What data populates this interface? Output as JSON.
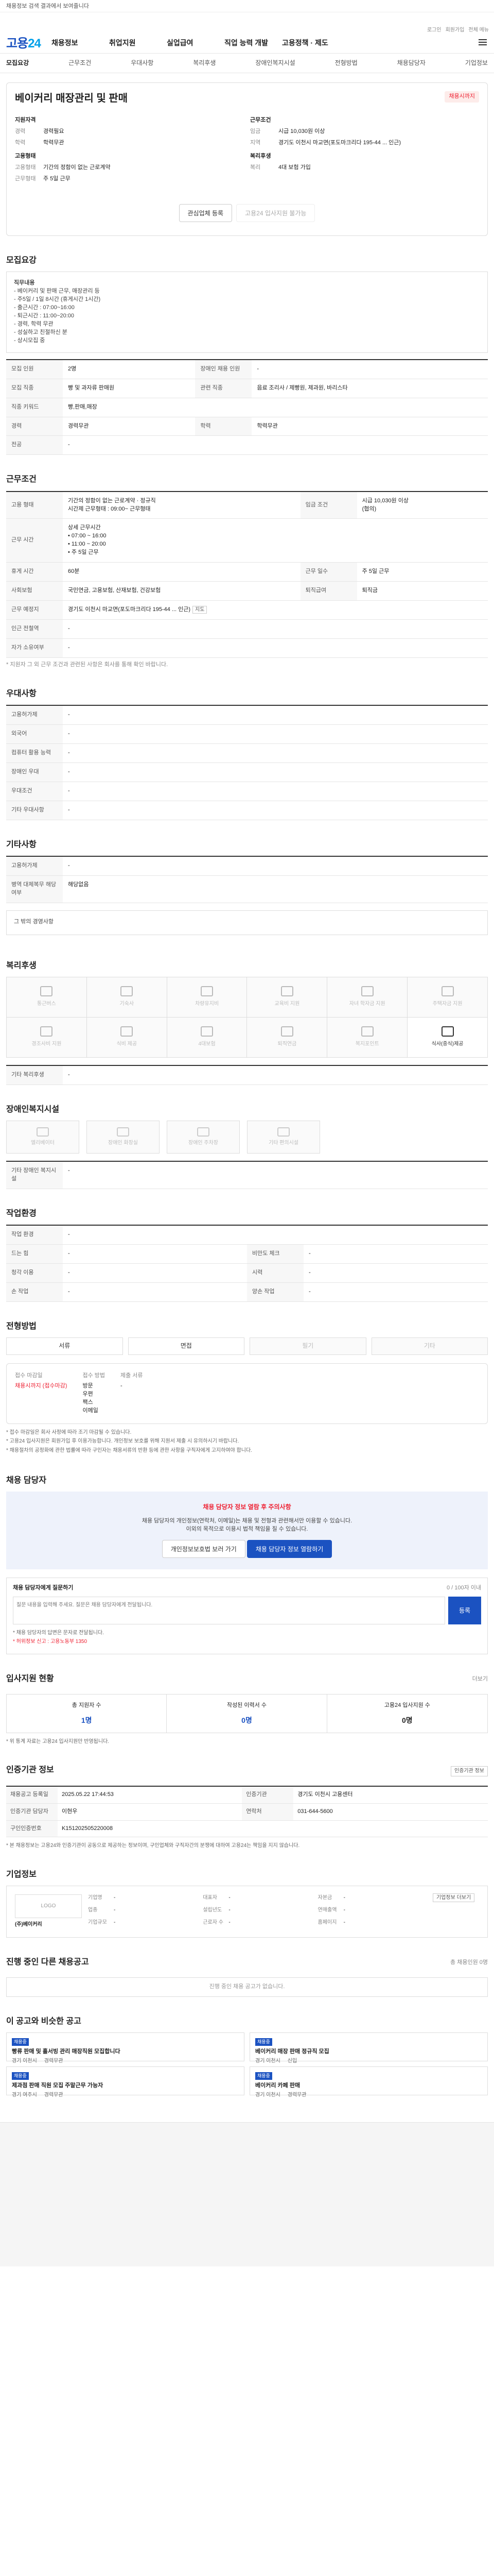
{
  "topnote": "채용정보 검색 결과에서 보여줄니다",
  "brand": {
    "a": "고용",
    "b": "24"
  },
  "utils": [
    "로그인",
    "회원가입",
    "전체 메뉴"
  ],
  "gnb": [
    "채용정보",
    "취업지원",
    "실업급여",
    "직업 능력 개발",
    "고용정책 · 제도"
  ],
  "tabs": [
    "모집요강",
    "근무조건",
    "우대사항",
    "복리후생",
    "장애인복지시설",
    "전형방법",
    "채용담당자",
    "기업정보"
  ],
  "job": {
    "title": "베이커리 매장관리 및 판매",
    "dday": "채용시까지",
    "left": [
      [
        "지원자격",
        ""
      ],
      [
        "경력",
        "경력필요"
      ],
      [
        "학력",
        "학력무관"
      ]
    ],
    "right": [
      [
        "근무조건",
        ""
      ],
      [
        "임금",
        "시급 10,030원 이상"
      ],
      [
        "지역",
        "경기도 이천시 마교면(포도마크리다 195-44 ... 인근)"
      ]
    ],
    "left2_head": "고용형태",
    "left2": [
      [
        "고용형태",
        "기간의 정함이 없는 근로계약"
      ],
      [
        "근무형태",
        "주 5일 근무"
      ]
    ],
    "right2_head": "복리후생",
    "right2": [
      [
        "복리",
        "4대 보험 가입"
      ]
    ],
    "btn_scrap": "관심업체 등록",
    "btn_apply": "고용24 입사지원 불가능"
  },
  "recruit": {
    "title": "모집요강",
    "content_title": "직무내용",
    "content": "- 베이커리 및 판매 근무, 매장관리 등\n- 주5일 / 1일 8시간 (휴게시간 1시간)\n- 출근시간 : 07:00~16:00\n- 퇴근시간 : 11:00~20:00\n- 경력, 학력 무관\n- 성실하고 친절하신 분\n- 상시모집 중",
    "rows": [
      [
        "모집 인원",
        "2명",
        "장애인 채용 인원",
        "-"
      ],
      [
        "모집 직종",
        "빵 및 과자류 판매원",
        "관련 직종",
        "음료 조리사 / 제빵원, 제과원, 바리스타"
      ],
      [
        "직종 키워드",
        "빵,판매,매장",
        null,
        null
      ],
      [
        "경력",
        "경력무관",
        "학력",
        "학력무관"
      ],
      [
        "전공",
        "-",
        null,
        null
      ]
    ]
  },
  "cond": {
    "title": "근무조건",
    "rows": [
      [
        "고용 형태",
        "기간의 정함이 없는 근로계약 · 정규직\n시간제 근무형태 : 09:00~ 근무형태",
        "임금 조건",
        "시급 10,030원 이상\n(협의)"
      ],
      [
        "근무 시간",
        "상세 근무시간\n• 07:00 ~ 16:00\n• 11:00 ~ 20:00\n• 주 5일 근무",
        null,
        null
      ],
      [
        "휴게 시간",
        "60분",
        "근무 일수",
        "주 5일 근무"
      ],
      [
        "사회보험",
        "국민연금, 고용보험, 산재보험, 건강보험",
        "퇴직급여",
        "퇴직금"
      ],
      [
        "근무 예정지",
        "경기도 이천시 마교면(포도마크리다 195-44 ... 인근)",
        null,
        null
      ],
      [
        "인근 전철역",
        "-",
        null,
        null
      ],
      [
        "자가 소유여부",
        "-",
        null,
        null
      ]
    ],
    "note": "* 지원자 그 외 근무 조건과 관련된 사항은 회사를 통해 확인 바랍니다.",
    "map": "지도"
  },
  "pref": {
    "title": "우대사항",
    "rows": [
      [
        "고용허가제",
        "-"
      ],
      [
        "외국어",
        "-"
      ],
      [
        "컴퓨터 활용 능력",
        "-"
      ],
      [
        "장애인 우대",
        "-"
      ],
      [
        "우대조건",
        "-"
      ],
      [
        "기타 우대사항",
        "-"
      ]
    ]
  },
  "other": {
    "title": "기타사항",
    "rows": [
      [
        "고용허가제",
        "-"
      ],
      [
        "병역 대체복무 해당 여부",
        "해당없음"
      ]
    ],
    "extra": "그 밖의 경영사항"
  },
  "welfare": {
    "title": "복리후생",
    "items": [
      [
        "통근버스",
        false
      ],
      [
        "기숙사",
        false
      ],
      [
        "차량유지비",
        false
      ],
      [
        "교육비 지원",
        false
      ],
      [
        "자녀 학자금 지원",
        false
      ],
      [
        "주택자금 지원",
        false
      ],
      [
        "경조사비 지원",
        false
      ],
      [
        "식비 제공",
        false
      ],
      [
        "4대보험",
        false
      ],
      [
        "퇴직연금",
        false
      ],
      [
        "복지포인트",
        false
      ],
      [
        "식사(중식)제공",
        true
      ]
    ],
    "etc_label": "기타 복리후생",
    "etc_value": "-"
  },
  "disab": {
    "title": "장애인복지시설",
    "items": [
      "엘리베이터",
      "장애인 화장실",
      "장애인 주차장",
      "기타 편의시설"
    ],
    "etc_label": "기타 장애인 복지시설",
    "etc_value": "-"
  },
  "workenv": {
    "title": "작업환경",
    "rows": [
      [
        "작업 환경",
        "-",
        null,
        null
      ],
      [
        "드는 힘",
        "-",
        "비만도 체크",
        "-"
      ],
      [
        "청각 이용",
        "-",
        "시력",
        "-"
      ],
      [
        "손 작업",
        "-",
        "양손 작업",
        "-"
      ]
    ]
  },
  "method": {
    "title": "전형방법",
    "items": [
      [
        "서류",
        false
      ],
      [
        "면접",
        false
      ],
      [
        "필기",
        true
      ],
      [
        "기타",
        true
      ]
    ],
    "deadline_label": "접수 마감일",
    "deadline": "채용시까지 (접수마감)",
    "way_label": "접수 방법",
    "way": "방문\n우편\n팩스\n이메일",
    "docs_label": "제출 서류",
    "docs": "-",
    "notes": [
      "* 접수 마감일은 회사 사정에 따라 조기 마감될 수 있습니다.",
      "* 고용24 입사지원은 회원가입 후 이용가능합니다. 개인정보 보호를 위해 지원서 제출 시 유의하시기 바랍니다.",
      "* 채용절차의 공정화에 관한 법률에 따라 구인자는 채용서류의 반환 등에 관한 사항을 구직자에게 고지하여야 합니다."
    ]
  },
  "contact": {
    "title": "채용 담당자",
    "warn": "채용 담당자 정보 열람 후 주의사항",
    "desc": "채용 담당자의 개인정보(연락처, 이메일)는 채용 및 전형과 관련해서만 이용할 수 있습니다.\n이외의 목적으로 이용시 법적 책임을 질 수 있습니다.",
    "btn1": "개인정보보호법 보러 가기",
    "btn2": "채용 담당자 정보 열람하기",
    "q_title": "채용 담당자에게 질문하기",
    "q_count": "0 / 100자 이내",
    "q_placeholder": "질문 내용을 입력해 주세요. 질문은 채용 담당자에게 전달됩니다.",
    "q_send": "등록",
    "q_notes": [
      "* 채용 담당자의 답변은 문자로 전달됩니다.",
      "* 허위정보 신고 : 고용노동부 1350"
    ]
  },
  "apply": {
    "title": "입사지원 현황",
    "more": "더보기",
    "stats": [
      [
        "총 지원자 수",
        "1명"
      ],
      [
        "작성된 이력서 수",
        "0명"
      ],
      [
        "고용24 입사지원 수",
        "0명"
      ]
    ],
    "note": "* 위 통계 자료는 고용24 입사지원만 반영됩니다."
  },
  "info": {
    "title": "인증기관 정보",
    "btn": "인증기관 정보",
    "rows": [
      [
        "채용공고 등록일",
        "2025.05.22 17:44:53",
        "인증기관",
        "경기도 이천시 고용센터"
      ],
      [
        "인증기관 담당자",
        "이현우",
        "연락처",
        "031-644-5600"
      ],
      [
        "구인인증번호",
        "K151202505220008",
        null,
        null
      ]
    ],
    "note": "* 본 채용정보는 고용24와 인증기관이 공동으로 제공하는 정보이며, 구인업체와 구직자간의 분쟁에 대하여 고용24는 책임을 지지 않습니다."
  },
  "company": {
    "title": "기업정보",
    "logo": "LOGO",
    "name": "(주)베이커리",
    "btn": "기업정보 더보기",
    "c1": [
      [
        "기업명",
        "-"
      ],
      [
        "업종",
        "-"
      ],
      [
        "기업규모",
        "-"
      ]
    ],
    "c2": [
      [
        "대표자",
        "-"
      ],
      [
        "설립년도",
        "-"
      ],
      [
        "근로자 수",
        "-"
      ]
    ],
    "c3": [
      [
        "자본금",
        "-"
      ],
      [
        "연매출액",
        "-"
      ],
      [
        "홈페이지",
        "-"
      ]
    ]
  },
  "others": {
    "title": "진행 중인 다른 채용공고",
    "note": "총 채용인원 0명",
    "empty": "진행 중인 채용 공고가 없습니다."
  },
  "reco": {
    "title": "이 공고와 비슷한 공고",
    "more": "",
    "cards": [
      [
        "채용중",
        "빵류 판매 및 홀서빙 관리 매장직원 모집합니다",
        "경기 이천시",
        "경력무관"
      ],
      [
        "채용중",
        "베이커리 매장 판매 정규직 모집",
        "경기 이천시",
        "신입"
      ],
      [
        "채용중",
        "제과점 판매 직원 모집 주말근무 가능자",
        "경기 여주시",
        "경력무관"
      ],
      [
        "채용중",
        "베이커리 카페 판매",
        "경기 이천시",
        "경력무관"
      ]
    ]
  }
}
